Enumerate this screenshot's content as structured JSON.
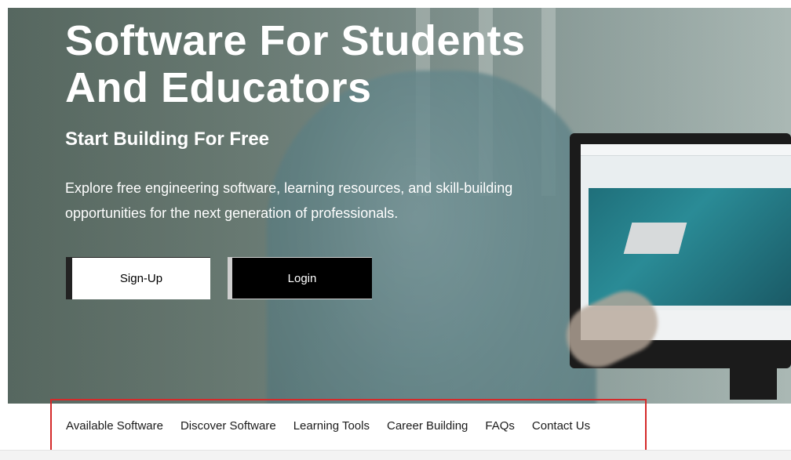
{
  "hero": {
    "title_line1": "Software For Students",
    "title_line2": "And Educators",
    "subtitle": "Start Building For Free",
    "description_line1": "Explore free engineering software, learning resources, and skill-building",
    "description_line2": "opportunities for the next generation of professionals."
  },
  "buttons": {
    "signup_label": "Sign-Up",
    "login_label": "Login"
  },
  "nav": {
    "items": [
      {
        "label": "Available Software"
      },
      {
        "label": "Discover Software"
      },
      {
        "label": "Learning Tools"
      },
      {
        "label": "Career Building"
      },
      {
        "label": "FAQs"
      },
      {
        "label": "Contact Us"
      }
    ]
  },
  "colors": {
    "highlight_border": "#d42a2a",
    "login_bg": "#000000",
    "signup_bg": "#ffffff"
  }
}
